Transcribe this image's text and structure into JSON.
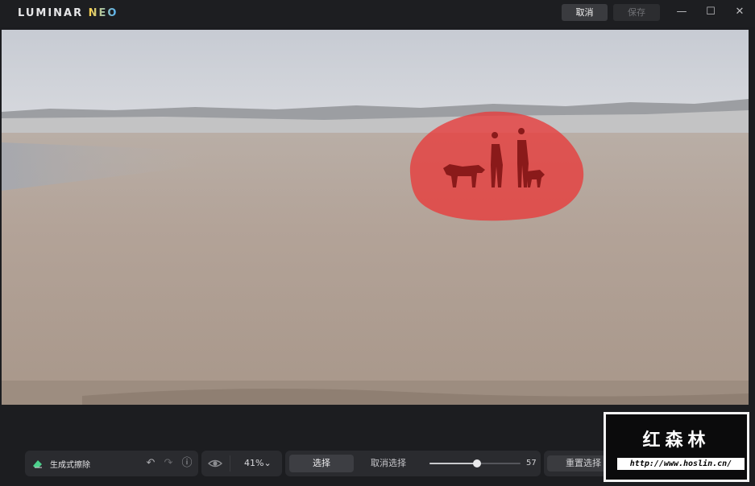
{
  "app": {
    "logo_main": "LUMINAR ",
    "logo_accent": "NEO"
  },
  "titlebar": {
    "cancel_label": "取消",
    "save_label": "保存"
  },
  "window_controls": {
    "minimize": "—",
    "maximize": "☐",
    "close": "✕"
  },
  "tool": {
    "name": "生成式擦除",
    "icon": "eraser-icon"
  },
  "history": {
    "undo": "↶",
    "redo": "↷",
    "info": "ⓘ"
  },
  "view": {
    "zoom": "41%",
    "zoom_caret": "⌄"
  },
  "selection": {
    "select_label": "选择",
    "deselect_label": "取消选择",
    "brush_size": "57",
    "brush_fraction": 0.52
  },
  "reset": {
    "label": "重置选择"
  },
  "watermark": {
    "title": "红森林",
    "url": "http://www.hoslin.cn/"
  },
  "colors": {
    "accent": "#e83a3a",
    "mask_opacity": 0.75,
    "toolbar_bg": "#2a2b2f",
    "app_bg": "#1c1d20"
  }
}
